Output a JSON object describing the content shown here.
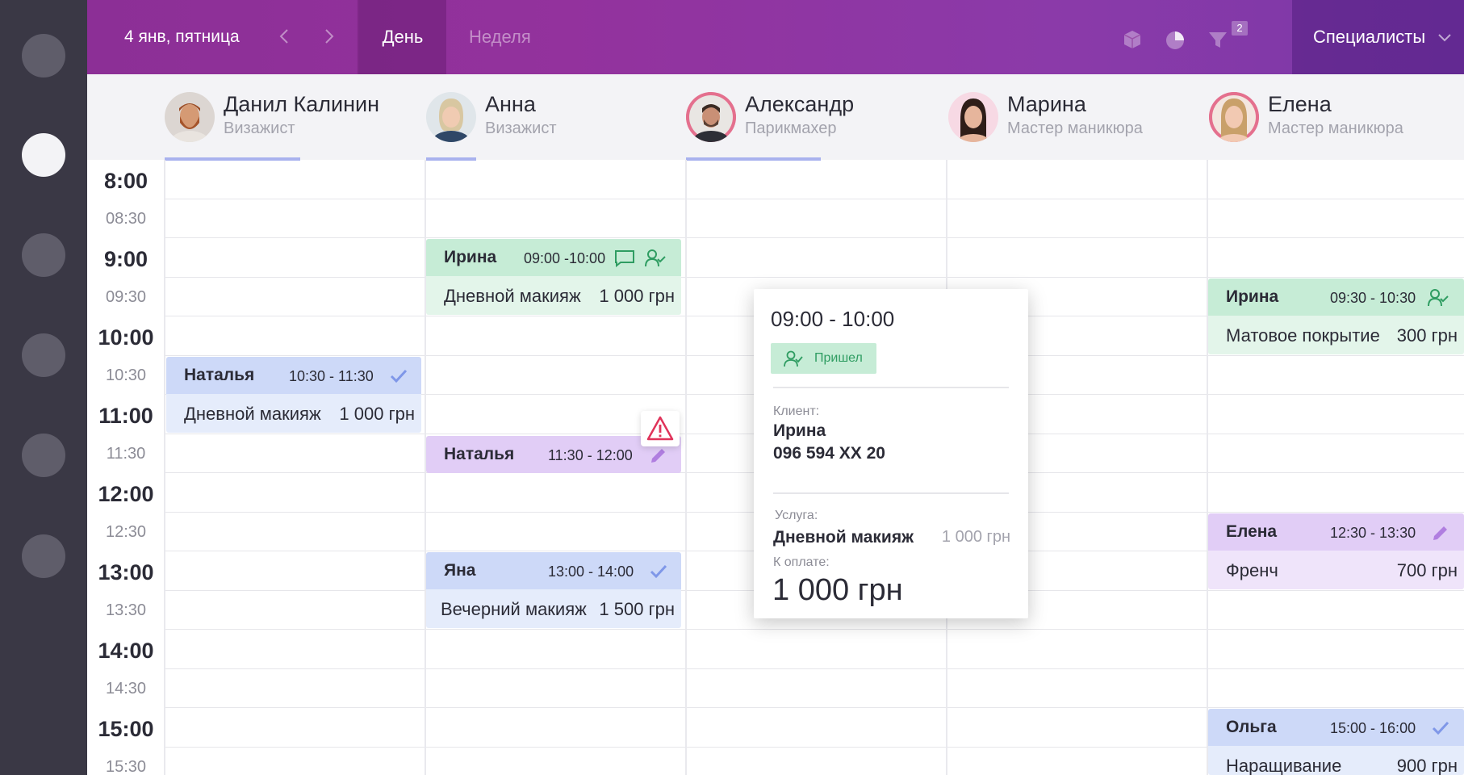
{
  "topbar": {
    "date": "4 янв, пятница",
    "view_day": "День",
    "view_week": "Неделя",
    "filter_count": "2",
    "specialists_label": "Специалисты",
    "icons": [
      "box-icon",
      "pie-chart-icon",
      "filter-icon"
    ]
  },
  "specialists": [
    {
      "name": "Данил Калинин",
      "role": "Визажист"
    },
    {
      "name": "Анна",
      "role": "Визажист"
    },
    {
      "name": "Александр",
      "role": "Парикмахер"
    },
    {
      "name": "Марина",
      "role": "Мастер маникюра"
    },
    {
      "name": "Елена",
      "role": "Мастер маникюра"
    }
  ],
  "times": [
    "8:00",
    "08:30",
    "9:00",
    "09:30",
    "10:00",
    "10:30",
    "11:00",
    "11:30",
    "12:00",
    "12:30",
    "13:00",
    "13:30",
    "14:00",
    "14:30",
    "15:00",
    "15:30"
  ],
  "events": [
    {
      "client": "Ирина",
      "time": "09:00 -10:00",
      "service": "Дневной макияж",
      "price": "1 000 грн",
      "color": "#c6ecd6"
    },
    {
      "client": "Наталья",
      "time": "10:30 - 11:30",
      "service": "Дневной макияж",
      "price": "1 000 грн",
      "color": "#cdd9f8"
    },
    {
      "client": "Наталья",
      "time": "11:30 - 12:00",
      "service": "",
      "price": "",
      "color": "#e1cdf6"
    },
    {
      "client": "Яна",
      "time": "13:00 - 14:00",
      "service": "Вечерний макияж",
      "price": "1 500 грн",
      "color": "#cdd9f8"
    },
    {
      "client": "Ирина",
      "time": "09:30 - 10:30",
      "service": "Матовое покрытие",
      "price": "300 грн",
      "color": "#c6ecd6"
    },
    {
      "client": "Елена",
      "time": "12:30 - 13:30",
      "service": "Френч",
      "price": "700 грн",
      "color": "#e1cdf6"
    },
    {
      "client": "Ольга",
      "time": "15:00 - 16:00",
      "service": "Наращивание",
      "price": "900 грн",
      "color": "#cdd9f8"
    }
  ],
  "popup": {
    "time": "09:00 - 10:00",
    "status": "Пришел",
    "client_label": "Клиент:",
    "client_name": "Ирина",
    "client_phone": "096 594 XX 20",
    "service_label": "Услуга:",
    "service_name": "Дневной макияж",
    "service_price": "1 000 грн",
    "pay_label": "К оплате:",
    "pay_total": "1 000 грн"
  },
  "colors": {
    "accent": "#8c2f96",
    "status_green": "#2f9d62",
    "status_blue": "#7f97e8",
    "status_purple": "#b07ee0",
    "warning": "#e0335a"
  }
}
